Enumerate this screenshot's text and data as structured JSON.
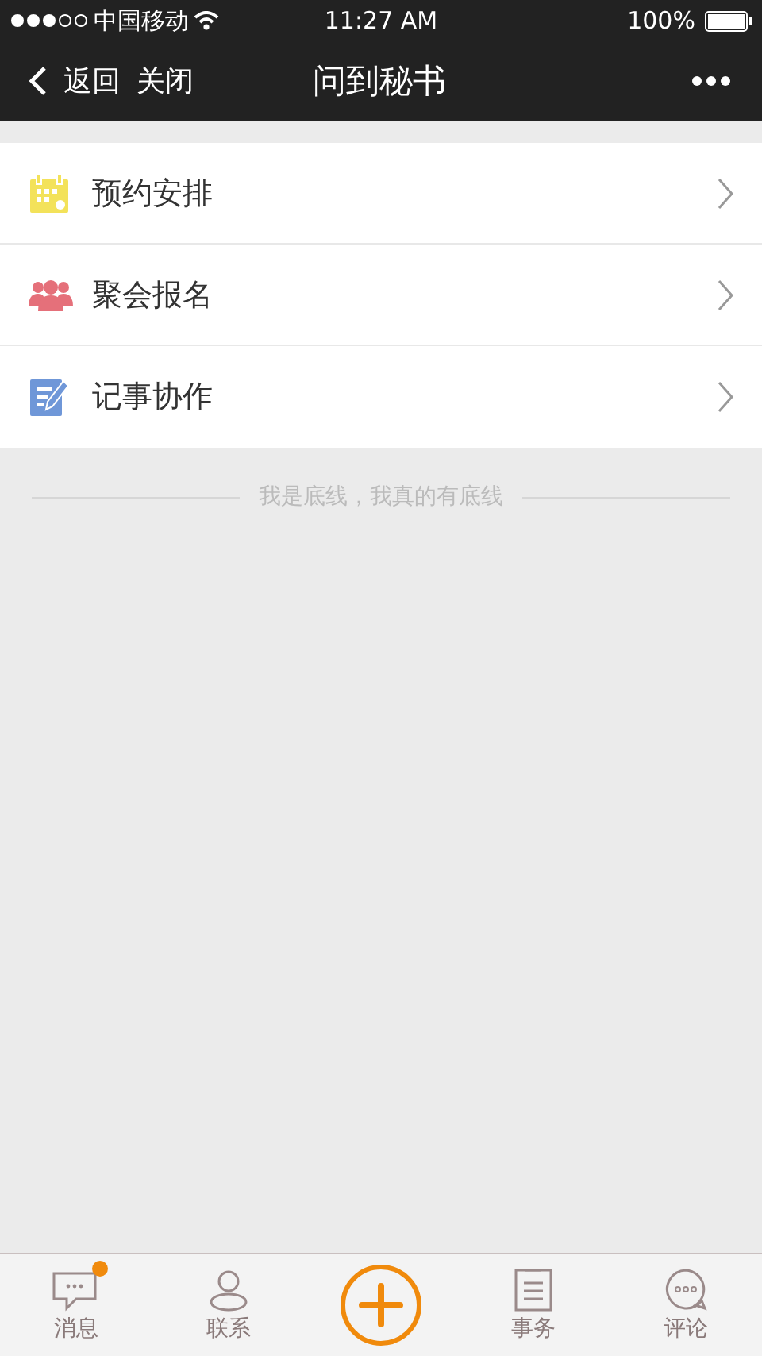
{
  "status_bar": {
    "carrier": "中国移动",
    "time": "11:27 AM",
    "battery": "100%"
  },
  "nav_bar": {
    "back": "返回",
    "close": "关闭",
    "title": "问到秘书"
  },
  "menu": [
    {
      "kind": "calendar",
      "label": "预约安排"
    },
    {
      "kind": "group",
      "label": "聚会报名"
    },
    {
      "kind": "note",
      "label": "记事协作"
    }
  ],
  "footer_note": "我是底线，我真的有底线",
  "tab_bar": [
    {
      "kind": "chat",
      "label": "消息",
      "badge": true
    },
    {
      "kind": "person",
      "label": "联系",
      "badge": false
    },
    {
      "kind": "add"
    },
    {
      "kind": "clipboard",
      "label": "事务",
      "badge": false
    },
    {
      "kind": "comment",
      "label": "评论",
      "badge": false
    }
  ]
}
